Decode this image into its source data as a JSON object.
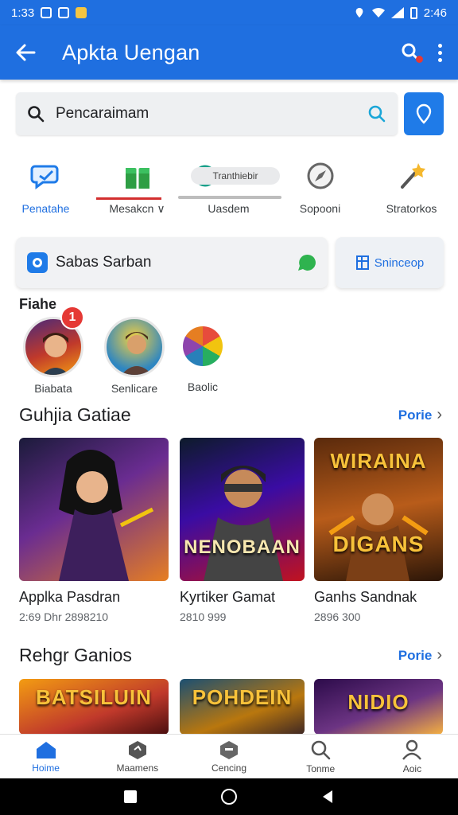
{
  "status_bar": {
    "time": "1:33",
    "right_time": "2:46"
  },
  "app_bar": {
    "title": "Apkta Uengan"
  },
  "search": {
    "text": "Pencaraimam"
  },
  "categories": [
    {
      "label": "Penatahe",
      "active": true
    },
    {
      "label": "Mesakcn ∨",
      "active": false
    },
    {
      "label": "Uasdem",
      "pill": "Tranthiebir",
      "active": false
    },
    {
      "label": "Sopooni",
      "active": false
    },
    {
      "label": "Stratorkos",
      "active": false
    }
  ],
  "promo": {
    "text": "Sabas Sarban",
    "button": "Sninceop"
  },
  "stories": {
    "title": "Fiahe",
    "items": [
      {
        "label": "Biabata",
        "badge": "1"
      },
      {
        "label": "Senlicare"
      },
      {
        "label": "Baolic"
      }
    ]
  },
  "section1": {
    "title": "Guhjia Gatiae",
    "more": "Porie",
    "cards": [
      {
        "name": "Applka Pasdran",
        "meta": "2:69 Dhr 2898210"
      },
      {
        "name": "Kyrtiker Gamat",
        "meta": "2810 999",
        "art_text": "NENOBAAN"
      },
      {
        "name": "Ganhs Sandnak",
        "meta": "2896 300",
        "art_text_top": "WIRAINA",
        "art_text_mid": "DIGANS"
      }
    ]
  },
  "section2": {
    "title": "Rehgr Ganios",
    "more": "Porie",
    "cards": [
      {
        "art_text": "BATSILUIN"
      },
      {
        "art_text": "POHDEIN"
      },
      {
        "art_text": "NIDIO"
      }
    ]
  },
  "bottom_nav": [
    {
      "label": "Hoime",
      "active": true
    },
    {
      "label": "Maamens"
    },
    {
      "label": "Cencing"
    },
    {
      "label": "Tonme"
    },
    {
      "label": "Aoic"
    }
  ],
  "colors": {
    "primary": "#1f6fe0",
    "badge": "#e53935"
  }
}
